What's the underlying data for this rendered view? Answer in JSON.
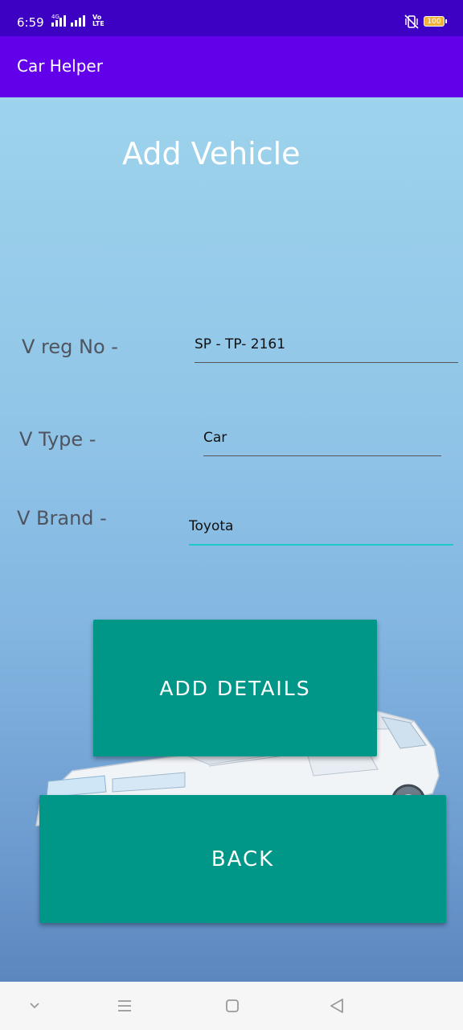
{
  "status_bar": {
    "time": "6:59",
    "network_tag": "4G",
    "volte_line1": "Vo",
    "volte_line2": "LTE",
    "battery": "100",
    "icons": [
      "signal-icon",
      "signal-icon",
      "mute-vibrate-icon",
      "battery-icon"
    ]
  },
  "app_bar": {
    "title": "Car Helper"
  },
  "form": {
    "title": "Add Vehicle",
    "reg_label": "V reg No -",
    "reg_value": "SP - TP- 2161",
    "type_label": "V Type -",
    "type_value": "Car",
    "brand_label": "V Brand -",
    "brand_value": "Toyota"
  },
  "buttons": {
    "add_label": "ADD DETAILS",
    "back_label": "BACK"
  },
  "nav_bar": {
    "icons": [
      "chevron-down-icon",
      "menu-icon",
      "home-icon",
      "back-icon"
    ]
  },
  "colors": {
    "status_bar": "#3d01c4",
    "app_bar": "#6200ea",
    "button": "#009688",
    "focus_underline": "#1ec8c8"
  }
}
